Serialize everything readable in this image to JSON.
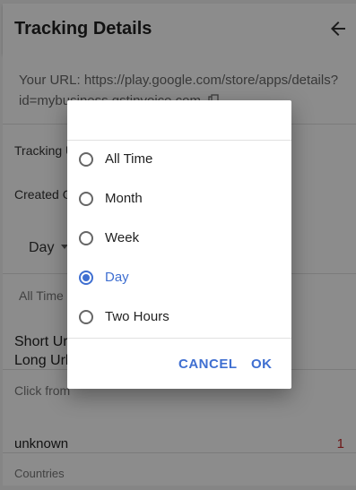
{
  "appbar": {
    "title": "Tracking Details",
    "back_icon": "arrow-left-icon"
  },
  "url_block": {
    "line1": "Your URL: https://play.google.com/store/apps/details?",
    "line2": "id=mybusiness.gstinvoice.com",
    "copy_icon": "copy-icon"
  },
  "rows": {
    "tracking_label": "Tracking U",
    "created_label": "Created O",
    "period_select": "Day",
    "all_time_label": "All Time",
    "short_url_label": "Short Ur",
    "long_url_label": "Long Url",
    "click_from_label": "Click from",
    "unknown_label": "unknown",
    "unknown_count": "1",
    "countries_label": "Countries"
  },
  "dialog": {
    "options": [
      {
        "label": "All Time",
        "checked": false
      },
      {
        "label": "Month",
        "checked": false
      },
      {
        "label": "Week",
        "checked": false
      },
      {
        "label": "Day",
        "checked": true
      },
      {
        "label": "Two Hours",
        "checked": false
      }
    ],
    "cancel_label": "CANCEL",
    "ok_label": "OK",
    "accent_color": "#3f6fd1"
  }
}
